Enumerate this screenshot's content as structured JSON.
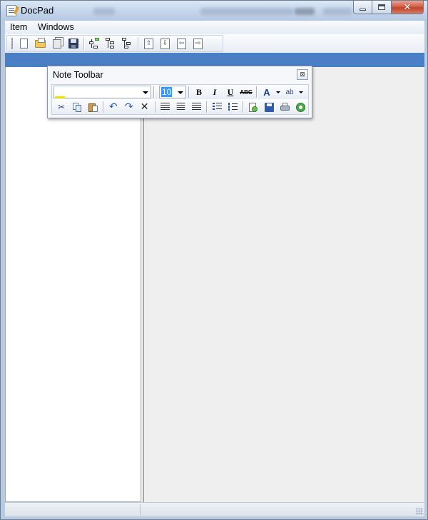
{
  "window": {
    "title": "DocPad",
    "minimize_icon": "minimize-icon",
    "maximize_icon": "maximize-icon",
    "close_icon": "close-icon",
    "close_glyph": "✕"
  },
  "menubar": {
    "items": [
      {
        "label": "Item"
      },
      {
        "label": "Windows"
      }
    ]
  },
  "toolbar": {
    "buttons": [
      {
        "icon": "new-document-icon"
      },
      {
        "icon": "open-folder-icon"
      },
      {
        "icon": "copy-document-icon"
      },
      {
        "icon": "save-icon"
      },
      {
        "icon": "add-child-node-icon"
      },
      {
        "icon": "add-sibling-node-icon"
      },
      {
        "icon": "add-node-below-icon"
      },
      {
        "icon": "move-up-icon",
        "glyph": "⇧"
      },
      {
        "icon": "move-down-icon",
        "glyph": "⇩"
      },
      {
        "icon": "move-left-icon",
        "glyph": "⇦"
      },
      {
        "icon": "move-right-icon",
        "glyph": "⇨"
      }
    ]
  },
  "note_toolbar": {
    "title": "Note Toolbar",
    "close_glyph": "⊠",
    "font_name": "",
    "font_size": "10",
    "format": {
      "bold": "B",
      "italic": "I",
      "underline": "U",
      "strikethrough": "ABC",
      "font_color": "A",
      "highlight": "ab"
    },
    "colors": {
      "font_color_bar": "#e02020",
      "highlight_bar": "#f0e000",
      "accent_blue": "#4a7fc6",
      "selection": "#3399ff"
    },
    "row2_icons": [
      "cut-icon",
      "copy-icon",
      "paste-icon",
      "undo-icon",
      "redo-icon",
      "delete-icon",
      "align-left-icon",
      "align-center-icon",
      "align-right-icon",
      "bullet-list-icon",
      "numbered-list-icon",
      "insert-image-icon",
      "save-note-icon",
      "print-icon",
      "refresh-icon"
    ],
    "glyphs": {
      "cut": "✂",
      "undo": "↶",
      "redo": "↷",
      "delete": "✕"
    }
  }
}
